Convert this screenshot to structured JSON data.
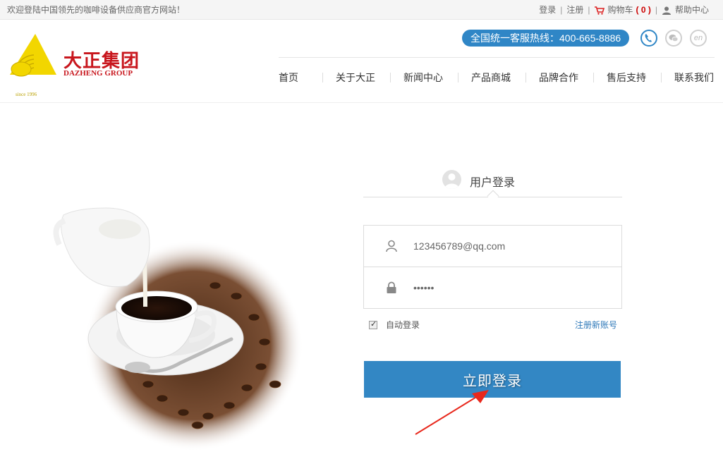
{
  "topbar": {
    "welcome": "欢迎登陆中国领先的咖啡设备供应商官方网站！",
    "login": "登录",
    "register": "注册",
    "cart": "购物车",
    "cart_count": "( 0 )",
    "help": "帮助中心",
    "sep": "|"
  },
  "header": {
    "logo_cn": "大正集团",
    "logo_en": "DAZHENG GROUP",
    "logo_since": "since 1996",
    "hotline": "全国统一客服热线：400-665-8886",
    "en_label": "en",
    "nav": [
      "首页",
      "关于大正",
      "新闻中心",
      "产品商城",
      "品牌合作",
      "售后支持",
      "联系我们"
    ]
  },
  "login": {
    "title": "用户登录",
    "username": "123456789@qq.com",
    "password": "••••••",
    "remember": "自动登录",
    "register": "注册新账号",
    "submit": "立即登录"
  },
  "colors": {
    "accent": "#3387c4",
    "brand_red": "#c8161d",
    "logo_yellow": "#f2d600",
    "annotation_red": "#e8281c"
  },
  "icons": {
    "cart": "cart-icon",
    "user": "user-icon",
    "phone": "phone-icon",
    "wechat": "wechat-icon",
    "lock": "lock-icon"
  }
}
